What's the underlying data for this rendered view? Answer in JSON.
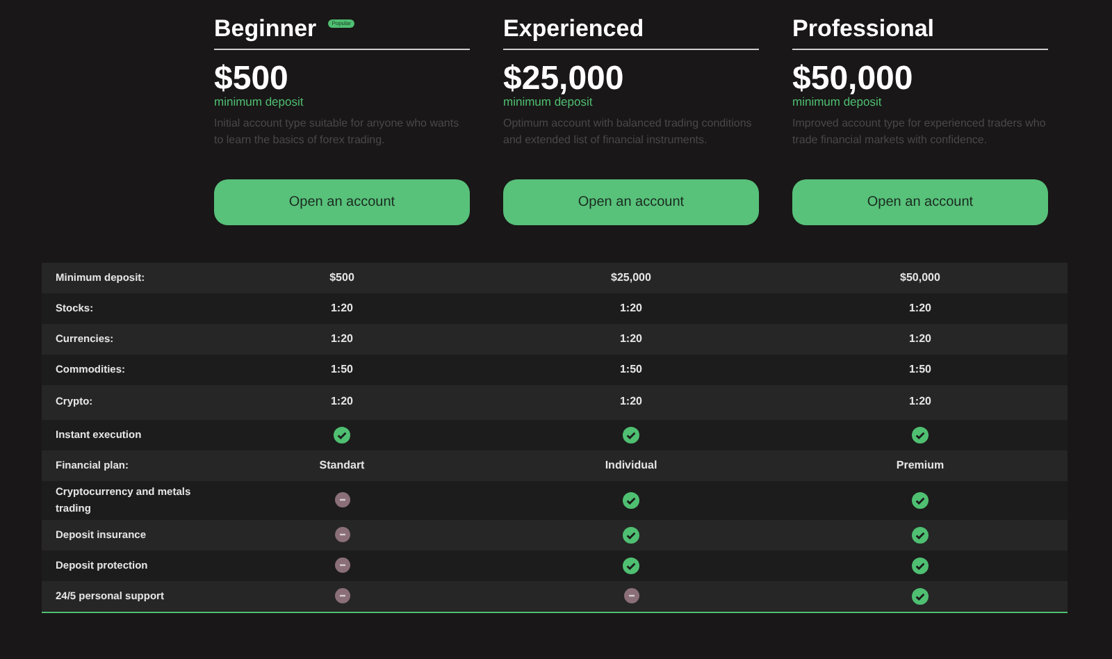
{
  "plans": [
    {
      "name": "Beginner",
      "badge": "Popular",
      "price": "$500",
      "price_caption": "minimum deposit",
      "description": "Initial account type suitable for anyone who wants to learn the basics of forex trading.",
      "button": "Open an account"
    },
    {
      "name": "Experienced",
      "price": "$25,000",
      "price_caption": "minimum deposit",
      "description": "Optimum account with balanced trading conditions and extended list of financial instruments.",
      "button": "Open an account"
    },
    {
      "name": "Professional",
      "price": "$50,000",
      "price_caption": "minimum deposit",
      "description": "Improved account type for experienced traders who trade financial markets with confidence.",
      "button": "Open an account"
    }
  ],
  "table": {
    "rows": [
      {
        "label": "Minimum deposit:",
        "cells": [
          {
            "kind": "text",
            "text": "$500"
          },
          {
            "kind": "text",
            "text": "$25,000"
          },
          {
            "kind": "text",
            "text": "$50,000"
          }
        ]
      },
      {
        "label": "Stocks:",
        "cells": [
          {
            "kind": "text",
            "text": "1:20"
          },
          {
            "kind": "text",
            "text": "1:20"
          },
          {
            "kind": "text",
            "text": "1:20"
          }
        ]
      },
      {
        "label": "Currencies:",
        "cells": [
          {
            "kind": "text",
            "text": "1:20"
          },
          {
            "kind": "text",
            "text": "1:20"
          },
          {
            "kind": "text",
            "text": "1:20"
          }
        ]
      },
      {
        "label": "Commodities:",
        "cells": [
          {
            "kind": "text",
            "text": "1:50"
          },
          {
            "kind": "text",
            "text": "1:50"
          },
          {
            "kind": "text",
            "text": "1:50"
          }
        ]
      },
      {
        "label": "Crypto:",
        "cells": [
          {
            "kind": "text",
            "text": "1:20"
          },
          {
            "kind": "text",
            "text": "1:20"
          },
          {
            "kind": "text",
            "text": "1:20"
          }
        ]
      },
      {
        "label": "Instant execution",
        "cells": [
          {
            "kind": "check"
          },
          {
            "kind": "check"
          },
          {
            "kind": "check"
          }
        ]
      },
      {
        "label": "Financial plan:",
        "cells": [
          {
            "kind": "text",
            "text": "Standart"
          },
          {
            "kind": "text",
            "text": "Individual"
          },
          {
            "kind": "text",
            "text": "Premium"
          }
        ]
      },
      {
        "label": "Cryptocurrency and metals trading",
        "cells": [
          {
            "kind": "dash"
          },
          {
            "kind": "check"
          },
          {
            "kind": "check"
          }
        ]
      },
      {
        "label": "Deposit insurance",
        "cells": [
          {
            "kind": "dash"
          },
          {
            "kind": "check"
          },
          {
            "kind": "check"
          }
        ]
      },
      {
        "label": "Deposit protection",
        "cells": [
          {
            "kind": "dash"
          },
          {
            "kind": "check"
          },
          {
            "kind": "check"
          }
        ]
      },
      {
        "label": "24/5 personal support",
        "cells": [
          {
            "kind": "dash"
          },
          {
            "kind": "dash"
          },
          {
            "kind": "check"
          }
        ]
      }
    ]
  }
}
